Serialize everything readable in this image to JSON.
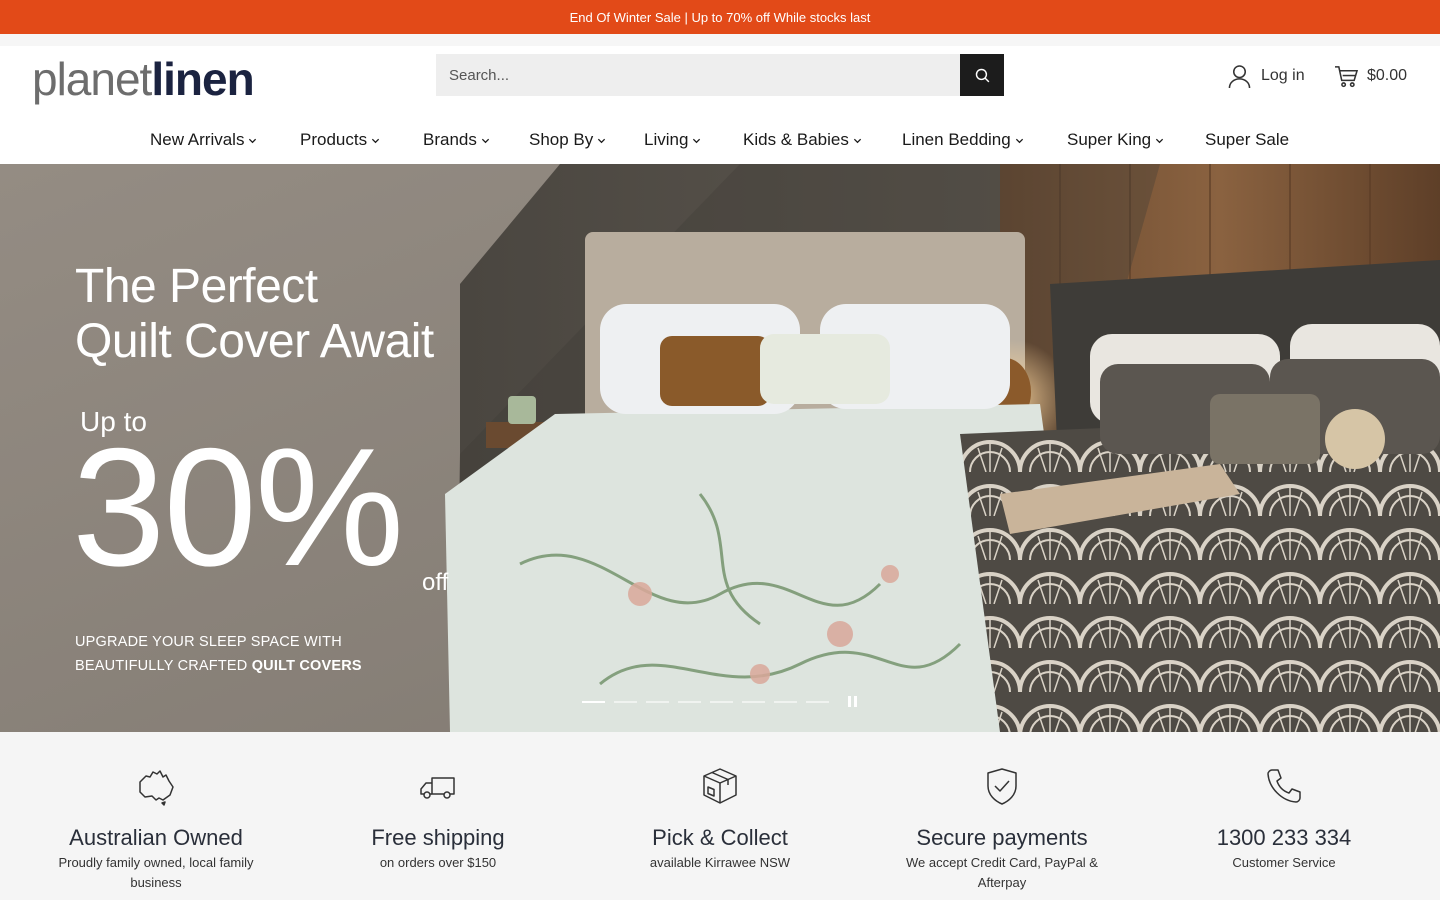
{
  "announcement": "End Of Winter Sale | Up to 70% off While stocks last",
  "logo": {
    "part1": "planet",
    "part2": "linen"
  },
  "search": {
    "placeholder": "Search...",
    "icon": "search-icon"
  },
  "account": {
    "login_label": "Log in",
    "icon": "user-icon"
  },
  "cart": {
    "total": "$0.00",
    "icon": "cart-icon"
  },
  "nav": {
    "items": [
      {
        "label": "New Arrivals"
      },
      {
        "label": "Products"
      },
      {
        "label": "Brands"
      },
      {
        "label": "Shop By"
      },
      {
        "label": "Living"
      },
      {
        "label": "Kids & Babies"
      },
      {
        "label": "Linen Bedding"
      },
      {
        "label": "Super King"
      },
      {
        "label": "Super Sale"
      }
    ]
  },
  "hero": {
    "title_line1": "The Perfect",
    "title_line2": "Quilt Cover Await",
    "up_to": "Up to",
    "percent": "30%",
    "off": "off",
    "sub_line1": "UPGRADE YOUR SLEEP SPACE WITH",
    "sub_line2_plain": "BEAUTIFULLY CRAFTED ",
    "sub_line2_bold": "QUILT COVERS",
    "slide_count": 8,
    "active_slide": 1
  },
  "features": [
    {
      "icon": "australia-map-icon",
      "title": "Australian Owned",
      "desc": "Proudly family owned, local family business"
    },
    {
      "icon": "delivery-truck-icon",
      "title": "Free shipping",
      "desc": "on orders over $150"
    },
    {
      "icon": "package-box-icon",
      "title": "Pick & Collect",
      "desc": "available Kirrawee NSW"
    },
    {
      "icon": "shield-check-icon",
      "title": "Secure payments",
      "desc": "We accept Credit Card, PayPal & Afterpay"
    },
    {
      "icon": "phone-icon",
      "title": "1300 233 334",
      "desc": "Customer Service"
    }
  ],
  "colors": {
    "announcement_bg": "#e24a18",
    "logo_dark": "#1b2340",
    "search_button": "#1c1c1c"
  }
}
